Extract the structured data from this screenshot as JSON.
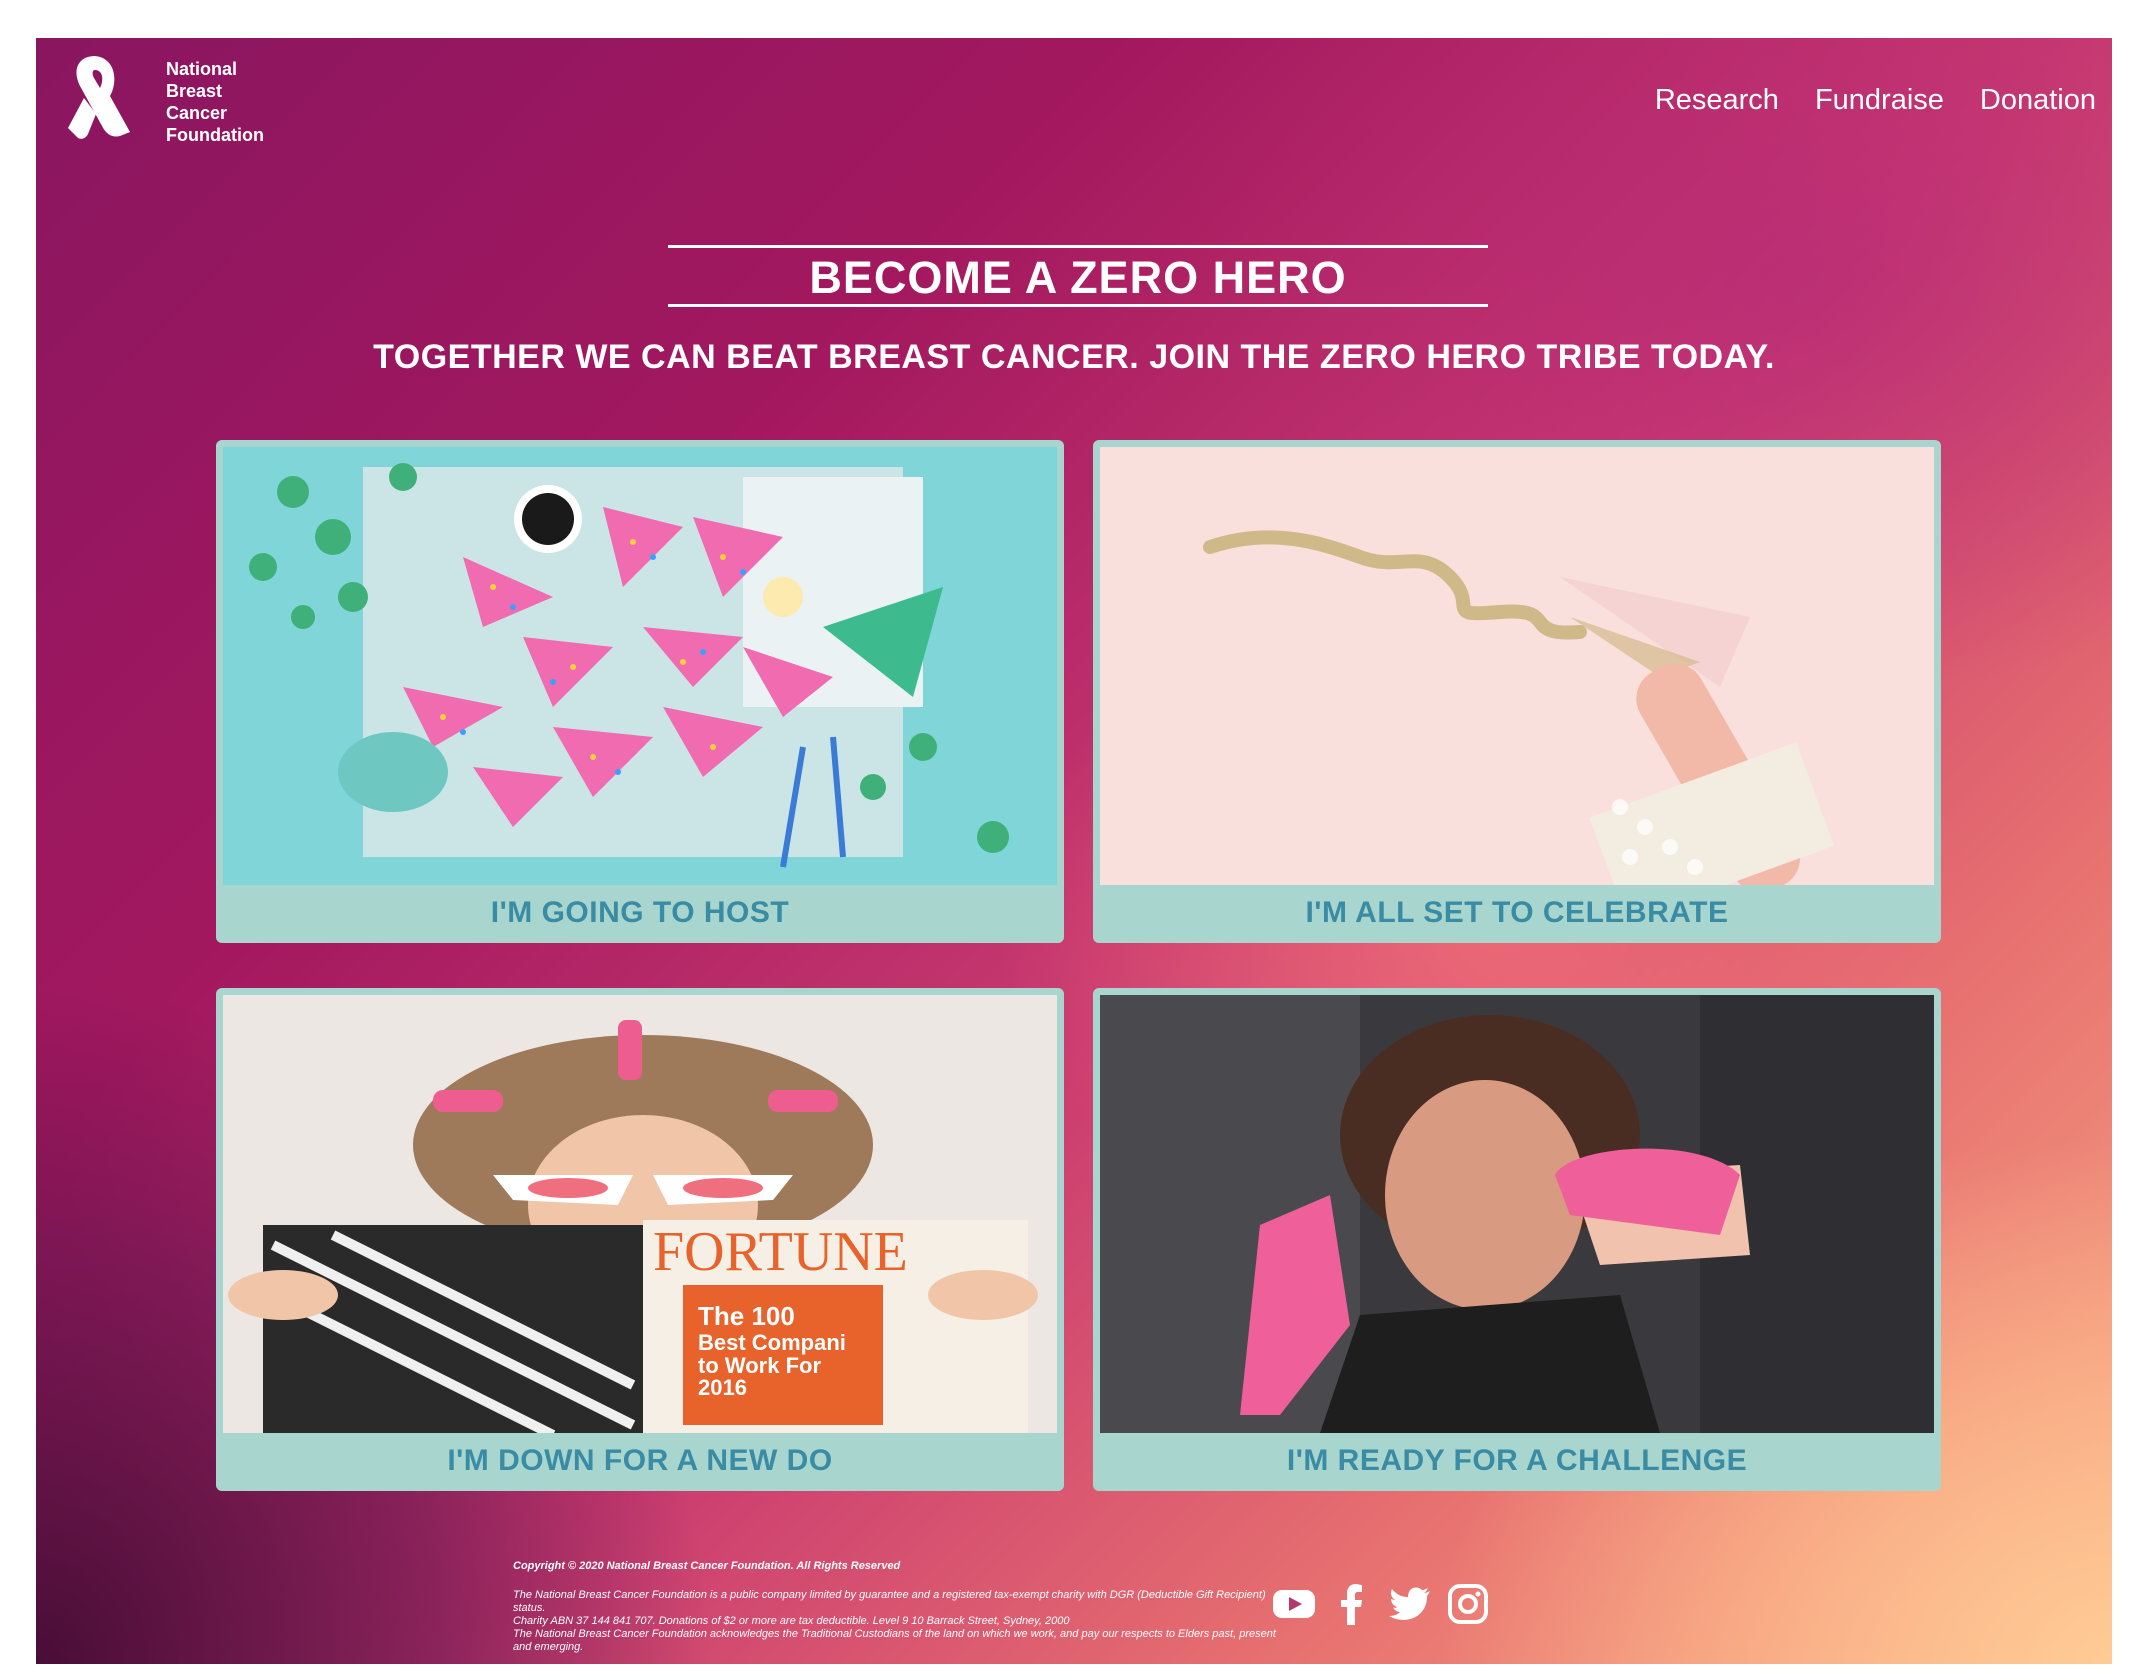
{
  "brand": {
    "logo_icon": "pink-ribbon-icon",
    "name_lines": [
      "National",
      "Breast",
      "Cancer",
      "Foundation"
    ]
  },
  "nav": {
    "items": [
      {
        "label": "Research"
      },
      {
        "label": "Fundraise"
      },
      {
        "label": "Donation"
      }
    ]
  },
  "hero": {
    "title": "BECOME A ZERO HERO",
    "subtitle": "TOGETHER WE CAN BEAT BREAST CANCER. JOIN THE ZERO HERO TRIBE TODAY."
  },
  "cards": [
    {
      "label": "I'M GOING TO HOST",
      "image": "party-food-sprinkles-photo"
    },
    {
      "label": "I'M ALL SET TO CELEBRATE",
      "image": "hand-holding-glitter-glass-photo"
    },
    {
      "label": "I'M DOWN FOR A NEW DO",
      "image": "woman-hair-rollers-magazine-photo"
    },
    {
      "label": "I'M READY FOR A CHALLENGE",
      "image": "woman-boxing-gloves-photo"
    }
  ],
  "magazine": {
    "masthead": "FORTUNE",
    "cover_lines": [
      "The 100",
      "Best Compani",
      "to Work For",
      "2016"
    ]
  },
  "footer": {
    "copyright": "Copyright © 2020 National Breast Cancer Foundation. All Rights Reserved",
    "lines": [
      "The National Breast Cancer Foundation is a public company limited by guarantee and a registered tax-exempt charity with DGR (Deductible Gift Recipient) status.",
      "Charity ABN 37 144 841 707. Donations of $2 or more are tax deductible. Level 9 10 Barrack Street, Sydney, 2000",
      "The National Breast Cancer Foundation acknowledges the Traditional Custodians of the land on which we work, and pay our respects to Elders past, present and emerging."
    ]
  },
  "social": [
    "youtube-icon",
    "facebook-icon",
    "twitter-icon",
    "instagram-icon"
  ],
  "colors": {
    "card_bg": "#a8d6cf",
    "card_text": "#3a8ba4",
    "background_start": "#8a1660",
    "background_end": "#f6a987"
  }
}
